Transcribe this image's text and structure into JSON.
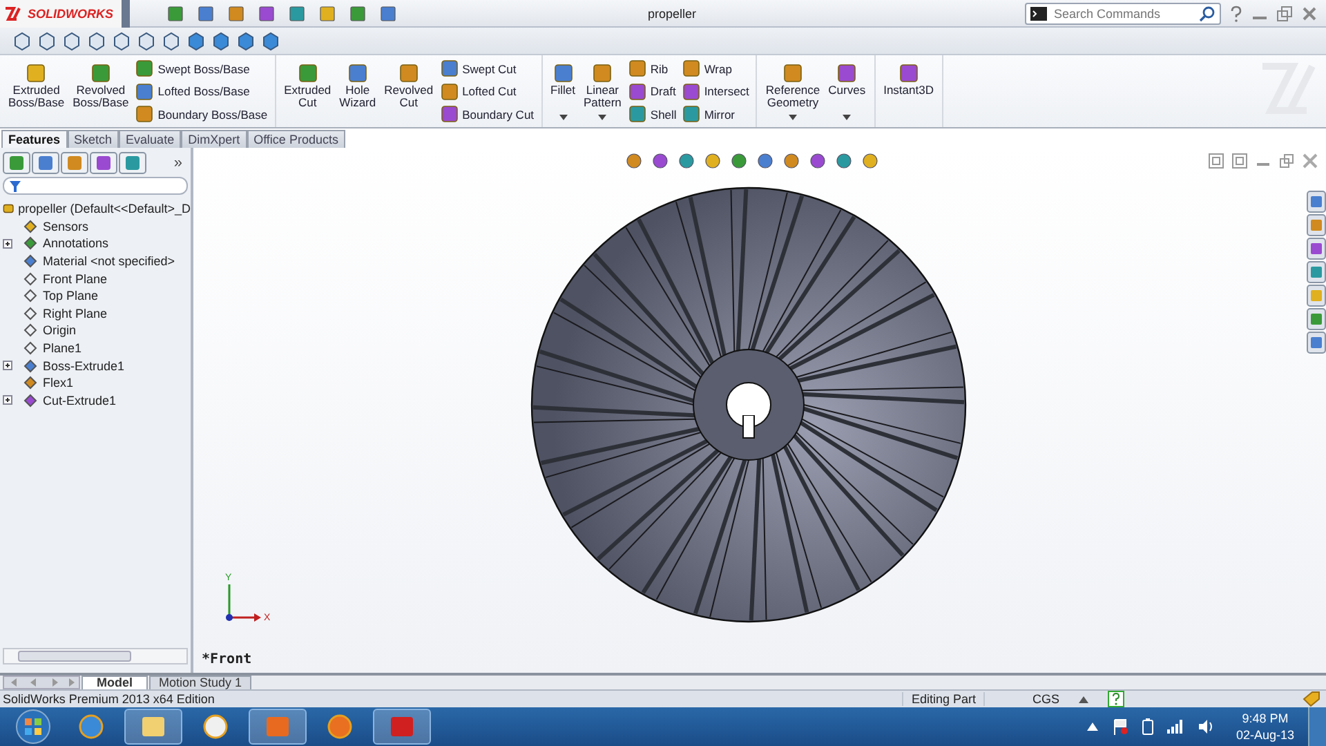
{
  "app": {
    "logo": "SOLIDWORKS",
    "title": "propeller",
    "search": {
      "placeholder": "Search Commands"
    }
  },
  "commands": [
    {
      "items": [
        {
          "kind": "large",
          "label": "Extruded Boss/Base",
          "dropdown": false
        },
        {
          "kind": "large",
          "label": "Revolved Boss/Base",
          "dropdown": false
        },
        {
          "kind": "stack",
          "items": [
            "Swept Boss/Base",
            "Lofted Boss/Base",
            "Boundary Boss/Base"
          ]
        }
      ]
    },
    {
      "items": [
        {
          "kind": "large",
          "label": "Extruded Cut",
          "dropdown": false
        },
        {
          "kind": "large",
          "label": "Hole Wizard",
          "dropdown": false
        },
        {
          "kind": "large",
          "label": "Revolved Cut",
          "dropdown": false
        },
        {
          "kind": "stack",
          "items": [
            "Swept Cut",
            "Lofted Cut",
            "Boundary Cut"
          ]
        }
      ]
    },
    {
      "items": [
        {
          "kind": "large",
          "label": "Fillet",
          "dropdown": true
        },
        {
          "kind": "large",
          "label": "Linear Pattern",
          "dropdown": true
        },
        {
          "kind": "stack",
          "items": [
            "Rib",
            "Draft",
            "Shell"
          ]
        },
        {
          "kind": "stack",
          "items": [
            "Wrap",
            "Intersect",
            "Mirror"
          ]
        }
      ]
    },
    {
      "items": [
        {
          "kind": "large",
          "label": "Reference Geometry",
          "dropdown": true
        },
        {
          "kind": "large",
          "label": "Curves",
          "dropdown": true
        }
      ]
    },
    {
      "items": [
        {
          "kind": "large",
          "label": "Instant3D",
          "dropdown": false
        }
      ]
    }
  ],
  "tabs": [
    {
      "label": "Features",
      "selected": true
    },
    {
      "label": "Sketch",
      "selected": false
    },
    {
      "label": "Evaluate",
      "selected": false
    },
    {
      "label": "DimXpert",
      "selected": false
    },
    {
      "label": "Office Products",
      "selected": false
    }
  ],
  "panel": {
    "more": "»",
    "tree": {
      "label": "propeller  (Default<<Default>_D",
      "children": [
        {
          "label": "Sensors",
          "expandable": false
        },
        {
          "label": "Annotations",
          "expandable": true
        },
        {
          "label": "Material <not specified>",
          "expandable": false
        },
        {
          "label": "Front Plane",
          "expandable": false
        },
        {
          "label": "Top Plane",
          "expandable": false
        },
        {
          "label": "Right Plane",
          "expandable": false
        },
        {
          "label": "Origin",
          "expandable": false
        },
        {
          "label": "Plane1",
          "expandable": false
        },
        {
          "label": "Boss-Extrude1",
          "expandable": true
        },
        {
          "label": "Flex1",
          "expandable": false
        },
        {
          "label": "Cut-Extrude1",
          "expandable": true
        }
      ]
    }
  },
  "viewport": {
    "view_label": "*Front",
    "axis_x": "X",
    "axis_y": "Y"
  },
  "bottom_tabs": [
    {
      "label": "Model",
      "selected": true
    },
    {
      "label": "Motion Study 1",
      "selected": false
    }
  ],
  "status_bar": {
    "product": "SolidWorks Premium 2013 x64 Edition",
    "mode": "Editing Part",
    "units": "CGS"
  },
  "taskbar": {
    "apps": [
      {
        "open": false
      },
      {
        "open": true
      },
      {
        "open": false
      },
      {
        "open": true
      },
      {
        "open": false
      },
      {
        "open": true
      }
    ],
    "time": "9:48 PM",
    "date": "02-Aug-13"
  }
}
